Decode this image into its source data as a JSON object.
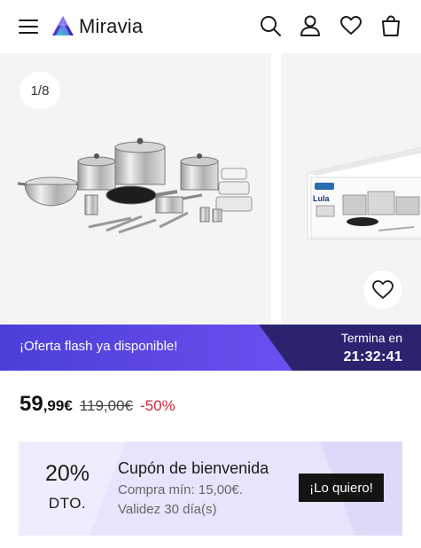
{
  "header": {
    "brand": "Miravia",
    "icons": [
      "menu-icon",
      "search-icon",
      "account-icon",
      "wishlist-icon",
      "cart-icon"
    ]
  },
  "gallery": {
    "counter": "1/8",
    "product_image": "stainless-steel-cookware-set",
    "next_image": "cookware-set-box-lula"
  },
  "flash": {
    "text": "¡Oferta flash ya disponible!",
    "ends_label": "Termina en",
    "time": "21:32:41"
  },
  "price": {
    "integer": "59",
    "decimals": ",99€",
    "original": "119,00€",
    "discount": "-50%"
  },
  "coupon": {
    "percent": "20%",
    "dto": "DTO.",
    "title": "Cupón de bienvenida",
    "min_purchase": "Compra mín: 15,00€.",
    "validity": "Validez 30 día(s)",
    "button": "¡Lo quiero!"
  },
  "colors": {
    "flash_dark": "#2a2470",
    "flash_accent": "#5a3fe0",
    "discount_red": "#d0263c",
    "coupon_bg": "#e7e5fb"
  }
}
